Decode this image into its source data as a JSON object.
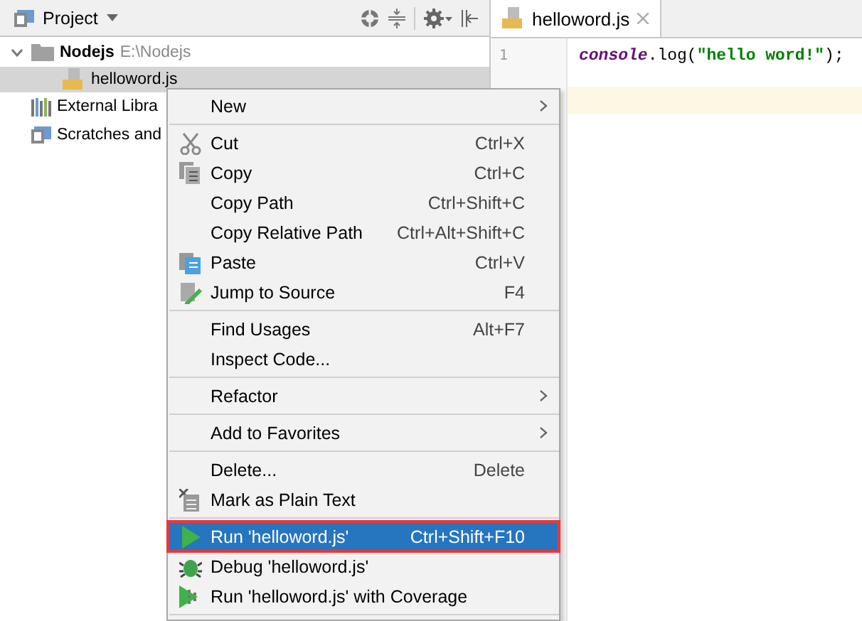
{
  "project_panel": {
    "title": "Project",
    "tree": [
      {
        "label": "Nodejs",
        "path": "E:\\Nodejs",
        "kind": "folder",
        "expanded": true,
        "selected": false,
        "children": [
          {
            "label": "helloword.js",
            "kind": "js",
            "selected": true
          }
        ]
      },
      {
        "label": "External Libra",
        "kind": "libraries",
        "selected": false
      },
      {
        "label": "Scratches and",
        "kind": "scratches",
        "selected": false
      }
    ]
  },
  "editor": {
    "tabs": [
      {
        "label": "helloword.js",
        "selected": true
      }
    ],
    "line_numbers": [
      "1"
    ],
    "code": [
      {
        "kind": "object",
        "text": "console"
      },
      {
        "kind": "plain",
        "text": ".log("
      },
      {
        "kind": "string",
        "text": "\"hello word!\""
      },
      {
        "kind": "plain",
        "text": ");"
      }
    ]
  },
  "context_menu": {
    "items": [
      {
        "kind": "item",
        "label": "New",
        "submenu": true,
        "selected": false
      },
      {
        "kind": "separator"
      },
      {
        "kind": "item",
        "label": "Cut",
        "shortcut": "Ctrl+X",
        "submenu": false,
        "selected": false
      },
      {
        "kind": "item",
        "label": "Copy",
        "shortcut": "Ctrl+C",
        "submenu": false,
        "selected": false
      },
      {
        "kind": "item",
        "label": "Copy Path",
        "shortcut": "Ctrl+Shift+C",
        "submenu": false,
        "selected": false
      },
      {
        "kind": "item",
        "label": "Copy Relative Path",
        "shortcut": "Ctrl+Alt+Shift+C",
        "submenu": false,
        "selected": false
      },
      {
        "kind": "item",
        "label": "Paste",
        "shortcut": "Ctrl+V",
        "submenu": false,
        "selected": false
      },
      {
        "kind": "item",
        "label": "Jump to Source",
        "shortcut": "F4",
        "submenu": false,
        "selected": false
      },
      {
        "kind": "separator"
      },
      {
        "kind": "item",
        "label": "Find Usages",
        "shortcut": "Alt+F7",
        "submenu": false,
        "selected": false
      },
      {
        "kind": "item",
        "label": "Inspect Code...",
        "submenu": false,
        "selected": false
      },
      {
        "kind": "separator"
      },
      {
        "kind": "item",
        "label": "Refactor",
        "submenu": true,
        "selected": false
      },
      {
        "kind": "separator"
      },
      {
        "kind": "item",
        "label": "Add to Favorites",
        "submenu": true,
        "selected": false
      },
      {
        "kind": "separator"
      },
      {
        "kind": "item",
        "label": "Delete...",
        "shortcut": "Delete",
        "submenu": false,
        "selected": false
      },
      {
        "kind": "item",
        "label": "Mark as Plain Text",
        "submenu": false,
        "selected": false
      },
      {
        "kind": "separator"
      },
      {
        "kind": "item",
        "label": "Run 'helloword.js'",
        "shortcut": "Ctrl+Shift+F10",
        "submenu": false,
        "selected": true
      },
      {
        "kind": "item",
        "label": "Debug 'helloword.js'",
        "submenu": false,
        "selected": false
      },
      {
        "kind": "item",
        "label": "Run 'helloword.js' with Coverage",
        "submenu": false,
        "selected": false
      },
      {
        "kind": "separator"
      }
    ]
  }
}
